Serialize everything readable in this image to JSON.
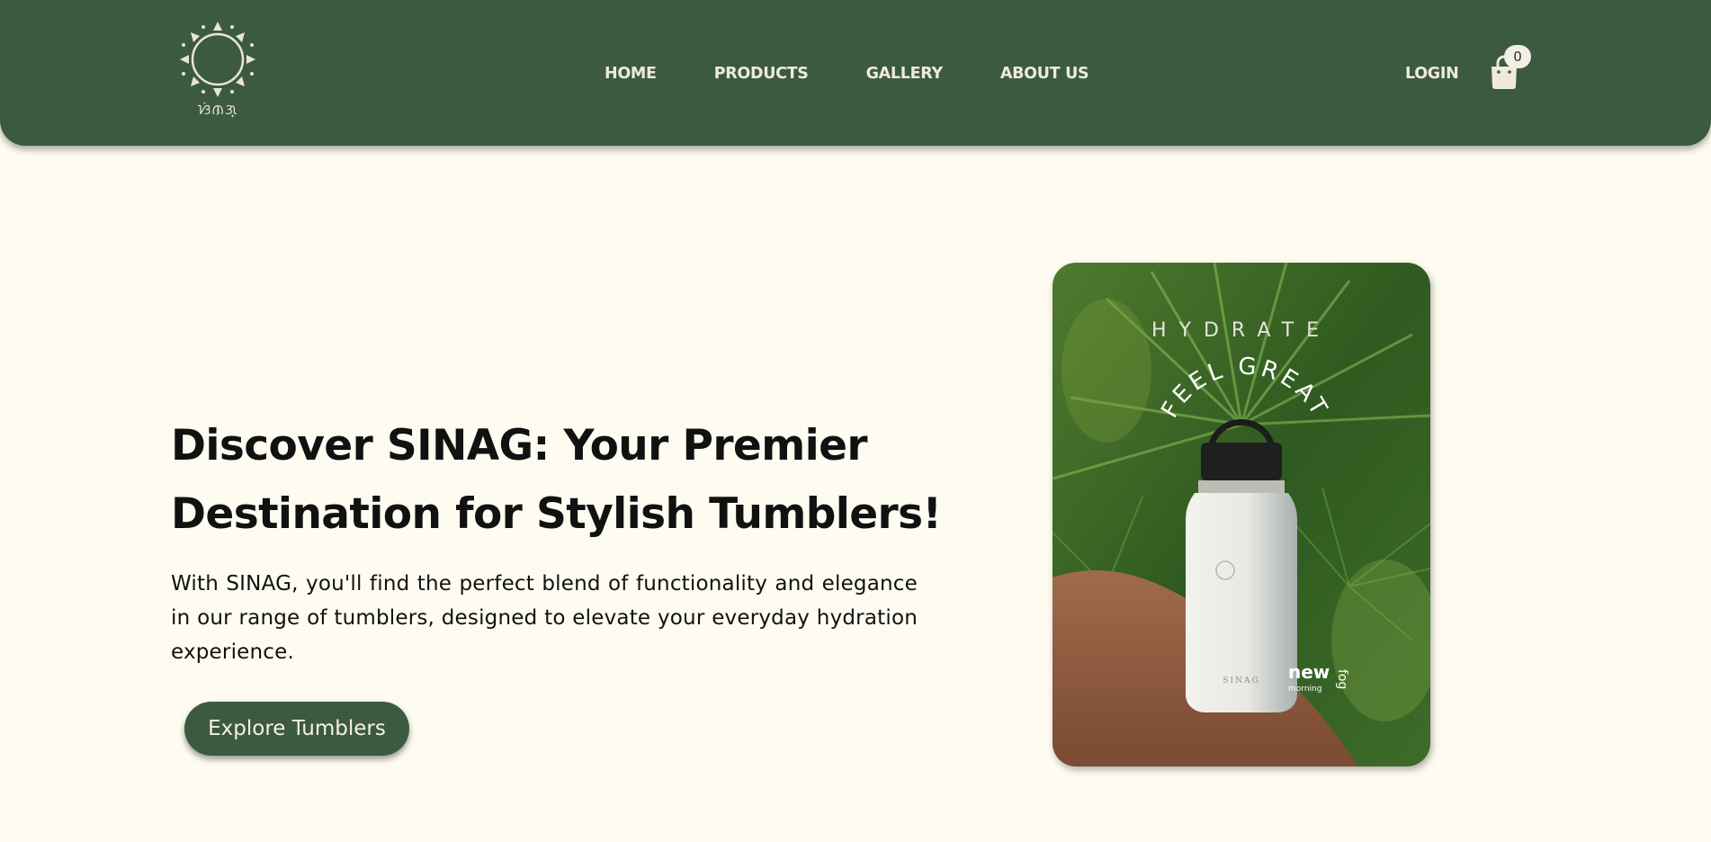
{
  "brand": {
    "logo_text": "ᜐᜒᜈᜄ᜔",
    "name": "SINAG"
  },
  "nav": {
    "links": [
      "HOME",
      "PRODUCTS",
      "GALLERY",
      "ABOUT US"
    ],
    "login": "LOGIN",
    "cart_count": "0",
    "cart_icon": "shopping-bag-icon"
  },
  "hero": {
    "title": "Discover SINAG: Your Premier Destination for Stylish Tumblers!",
    "description": "With SINAG, you'll find the perfect blend of functionality and elegance in our range of tumblers, designed to elevate your everyday hydration experience.",
    "cta_label": "Explore Tumblers"
  },
  "image": {
    "hydrate_text": "HYDRATE",
    "arc_text": "FEEL GREAT",
    "bottle_brand": "SINAG",
    "color_name_new": "new",
    "color_name_morning": "morning",
    "color_name_fog": "fog"
  },
  "colors": {
    "primary_green": "#3c5a40",
    "background": "#fefcf0",
    "nav_text": "#eeeadc"
  }
}
